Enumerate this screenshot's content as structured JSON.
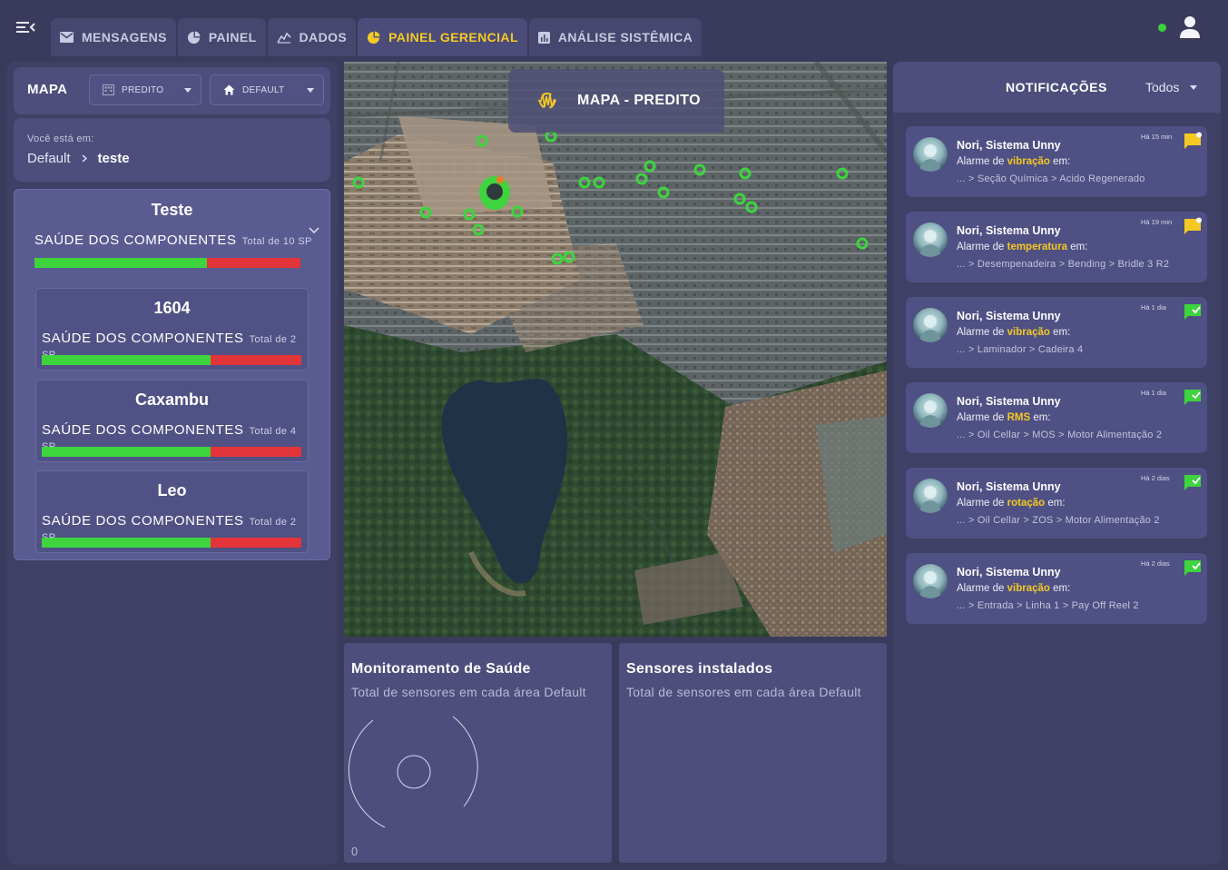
{
  "nav": {
    "tabs": [
      {
        "label": "MENSAGENS",
        "icon": "mail-icon"
      },
      {
        "label": "PAINEL",
        "icon": "pie-icon"
      },
      {
        "label": "DADOS",
        "icon": "chart-line-icon"
      },
      {
        "label": "PAINEL GERENCIAL",
        "icon": "pie-icon",
        "active": true
      },
      {
        "label": "ANÁLISE SISTÊMICA",
        "icon": "bar-chart-icon"
      }
    ],
    "status_color": "#3bd33d"
  },
  "sidebar": {
    "map_title": "MAPA",
    "dropdown_predito": "PREDITO",
    "dropdown_default": "DEFAULT",
    "you_are_in": "Você está em:",
    "breadcrumb": [
      "Default",
      "teste"
    ],
    "group": {
      "title": "Teste",
      "health_label": "SAÚDE DOS COMPONENTES",
      "total": "Total de 10 SP",
      "ok_fraction": 0.65
    },
    "cards": [
      {
        "title": "1604",
        "health_label": "SAÚDE DOS COMPONENTES",
        "total": "Total de 2 SP",
        "ok_fraction": 0.65
      },
      {
        "title": "Caxambu",
        "health_label": "SAÚDE DOS COMPONENTES",
        "total": "Total de 4 SP",
        "ok_fraction": 0.65
      },
      {
        "title": "Leo",
        "health_label": "SAÚDE DOS COMPONENTES",
        "total": "Total de 2 SP",
        "ok_fraction": 0.65
      }
    ]
  },
  "map": {
    "title": "MAPA - PREDITO",
    "marker_color": "#3ed43e"
  },
  "panels": {
    "health": {
      "title": "Monitoramento de Saúde",
      "subtitle": "Total de sensores em cada área Default",
      "value": "0"
    },
    "sensors": {
      "title": "Sensores instalados",
      "subtitle": "Total de sensores em cada área Default"
    }
  },
  "notifications": {
    "title": "NOTIFICAÇÕES",
    "filter": "Todos",
    "items": [
      {
        "from": "Nori, Sistema Unny",
        "prefix": "Alarme de ",
        "type": "vibração",
        "suffix": " em:",
        "path": "... > Seção Química > Acido Regenerado",
        "time": "Há 15 min",
        "status": "new"
      },
      {
        "from": "Nori, Sistema Unny",
        "prefix": "Alarme de ",
        "type": "temperatura",
        "suffix": " em:",
        "path": "... > Desempenadeira > Bending > Bridle 3 R2",
        "time": "Há 19 min",
        "status": "new"
      },
      {
        "from": "Nori, Sistema Unny",
        "prefix": "Alarme de ",
        "type": "vibração",
        "suffix": " em:",
        "path": "... > Laminador > Cadeira 4",
        "time": "Há 1 dia",
        "status": "read"
      },
      {
        "from": "Nori, Sistema Unny",
        "prefix": "Alarme de ",
        "type": "RMS",
        "suffix": " em:",
        "path": "... > Oil Cellar > MOS > Motor Alimentação 2",
        "time": "Há 1 dia",
        "status": "read"
      },
      {
        "from": "Nori, Sistema Unny",
        "prefix": "Alarme de ",
        "type": "rotação",
        "suffix": " em:",
        "path": "... > Oil Cellar > ZOS > Motor Alimentação 2",
        "time": "Há 2 dias",
        "status": "read"
      },
      {
        "from": "Nori, Sistema Unny",
        "prefix": "Alarme de ",
        "type": "vibração",
        "suffix": " em:",
        "path": "... > Entrada > Linha 1 > Pay Off Reel 2",
        "time": "Há 2 dias",
        "status": "read"
      }
    ]
  },
  "colors": {
    "accent": "#f5c924",
    "ok": "#3ed43e",
    "bad": "#e3343a",
    "new_icon": "#f5c924",
    "read_icon": "#3ed43e"
  }
}
